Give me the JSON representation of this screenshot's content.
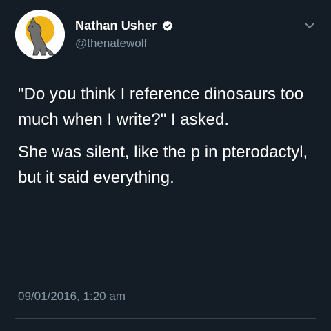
{
  "tweet": {
    "author": {
      "display_name": "Nathan Usher",
      "handle": "@thenatewolf",
      "verified": true,
      "avatar_icon": "howling-wolf-moon-avatar"
    },
    "text_paragraphs": [
      "\"Do you think I reference dinosaurs too much when I write?\" I asked.",
      "She was silent, like the p in pterodactyl, but it said everything."
    ],
    "timestamp": "09/01/2016, 1:20 am",
    "menu_icon": "chevron-down-icon"
  },
  "colors": {
    "background": "#141d26",
    "text": "#ffffff",
    "secondary_text": "#8899a6",
    "verified_badge": "#ffffff",
    "avatar_moon": "#f0b418"
  }
}
